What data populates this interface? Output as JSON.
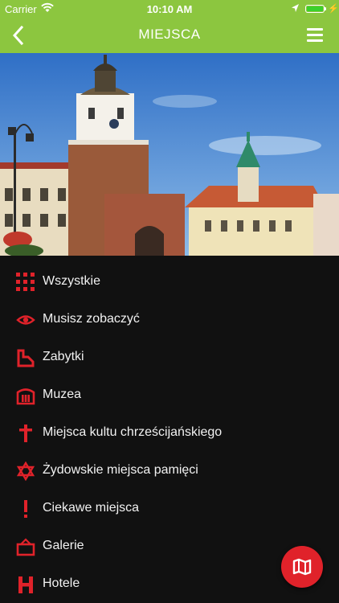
{
  "status": {
    "carrier": "Carrier",
    "time": "10:10 AM",
    "battery_level": 1.0
  },
  "nav": {
    "title": "MIEJSCA"
  },
  "hero": {
    "alt": ""
  },
  "colors": {
    "brand_green": "#8cc63f",
    "accent_red": "#e0222a",
    "background": "#111111"
  },
  "menu": {
    "items": [
      {
        "label": "Wszystkie",
        "icon": "grid-icon"
      },
      {
        "label": "Musisz zobaczyć",
        "icon": "eye-icon"
      },
      {
        "label": "Zabytki",
        "icon": "monument-icon"
      },
      {
        "label": "Muzea",
        "icon": "museum-icon"
      },
      {
        "label": "Miejsca kultu chrześcijańskiego",
        "icon": "cross-icon"
      },
      {
        "label": "Żydowskie miejsca pamięci",
        "icon": "star-of-david-icon"
      },
      {
        "label": "Ciekawe miejsca",
        "icon": "exclamation-icon"
      },
      {
        "label": "Galerie",
        "icon": "gallery-icon"
      },
      {
        "label": "Hotele",
        "icon": "hotel-icon"
      }
    ]
  },
  "fab": {
    "icon": "map-icon"
  }
}
